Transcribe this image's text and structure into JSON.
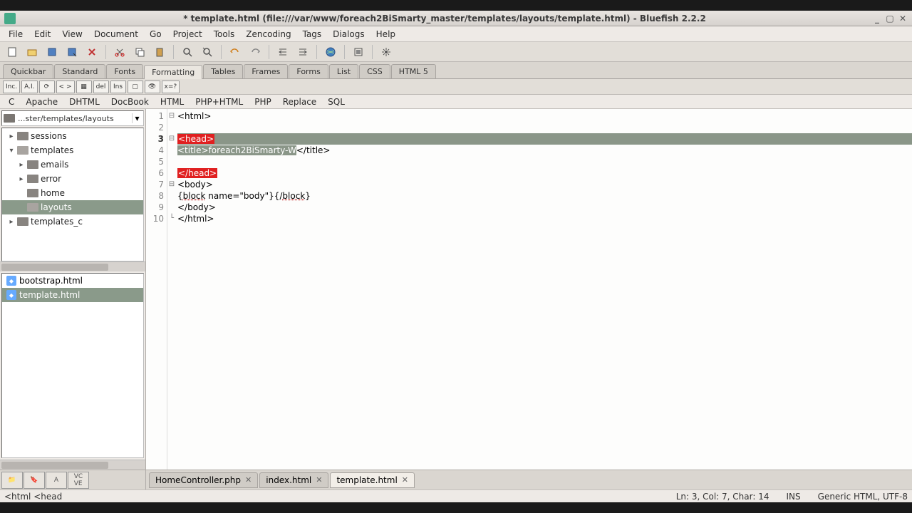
{
  "title": "* template.html (file:///var/www/foreach2BiSmarty_master/templates/layouts/template.html) - Bluefish 2.2.2",
  "menubar": [
    "File",
    "Edit",
    "View",
    "Document",
    "Go",
    "Project",
    "Tools",
    "Zencoding",
    "Tags",
    "Dialogs",
    "Help"
  ],
  "tool_tabs": [
    "Quickbar",
    "Standard",
    "Fonts",
    "Formatting",
    "Tables",
    "Frames",
    "Forms",
    "List",
    "CSS",
    "HTML 5"
  ],
  "tool_tabs_active": "Formatting",
  "fmt_btns": [
    "Inc.",
    "A.I.",
    "⟳",
    "< >",
    "▦",
    "del",
    "Ins",
    "▢",
    "👁",
    "x=?"
  ],
  "lang_row": [
    "C",
    "Apache",
    "DHTML",
    "DocBook",
    "HTML",
    "PHP+HTML",
    "PHP",
    "Replace",
    "SQL"
  ],
  "path_display": "...ster/templates/layouts",
  "tree": [
    {
      "level": 1,
      "label": "sessions",
      "exp": "▸",
      "icon": "folder"
    },
    {
      "level": 1,
      "label": "templates",
      "exp": "▾",
      "icon": "folder-open"
    },
    {
      "level": 2,
      "label": "emails",
      "exp": "▸",
      "icon": "folder"
    },
    {
      "level": 2,
      "label": "error",
      "exp": "▸",
      "icon": "folder"
    },
    {
      "level": 2,
      "label": "home",
      "exp": "",
      "icon": "folder"
    },
    {
      "level": 2,
      "label": "layouts",
      "exp": "",
      "icon": "folder-open",
      "selected": true
    },
    {
      "level": 1,
      "label": "templates_c",
      "exp": "▸",
      "icon": "folder"
    }
  ],
  "files": [
    {
      "name": "bootstrap.html",
      "selected": false
    },
    {
      "name": "template.html",
      "selected": true
    }
  ],
  "code": {
    "active_line": 3,
    "lines": [
      {
        "n": 1,
        "fold": "⊟",
        "segs": [
          {
            "t": "<html>",
            "cls": "tk-text"
          }
        ]
      },
      {
        "n": 2,
        "fold": "",
        "segs": []
      },
      {
        "n": 3,
        "fold": "⊟",
        "segs": [
          {
            "t": "<head>",
            "cls": "tag-hl"
          }
        ]
      },
      {
        "n": 4,
        "fold": "",
        "segs": [
          {
            "t": "<title>",
            "cls": "tag-sel"
          },
          {
            "t": "foreach2BiSmarty-W",
            "cls": "tag-sel"
          },
          {
            "t": "</title>",
            "cls": "tk-text"
          }
        ]
      },
      {
        "n": 5,
        "fold": "",
        "segs": []
      },
      {
        "n": 6,
        "fold": "",
        "segs": [
          {
            "t": "</head>",
            "cls": "tag-hl"
          }
        ]
      },
      {
        "n": 7,
        "fold": "⊟",
        "segs": [
          {
            "t": "<body>",
            "cls": "tk-text"
          }
        ]
      },
      {
        "n": 8,
        "fold": "",
        "segs": [
          {
            "t": "{",
            "cls": "tk-text"
          },
          {
            "t": "block",
            "cls": "tk-underline"
          },
          {
            "t": " name=\"body\"}{/",
            "cls": "tk-text"
          },
          {
            "t": "block",
            "cls": "tk-underline"
          },
          {
            "t": "}",
            "cls": "tk-text"
          }
        ]
      },
      {
        "n": 9,
        "fold": "",
        "segs": [
          {
            "t": "</body>",
            "cls": "tk-text"
          }
        ]
      },
      {
        "n": 10,
        "fold": "└",
        "segs": [
          {
            "t": "</html>",
            "cls": "tk-text"
          }
        ]
      }
    ]
  },
  "doc_tabs": [
    {
      "label": "HomeController.php",
      "active": false
    },
    {
      "label": "index.html",
      "active": false
    },
    {
      "label": "template.html",
      "active": true
    }
  ],
  "status": {
    "left": "<html <head",
    "pos": "Ln: 3, Col: 7, Char: 14",
    "ins": "INS",
    "mode": "Generic HTML, UTF-8"
  }
}
